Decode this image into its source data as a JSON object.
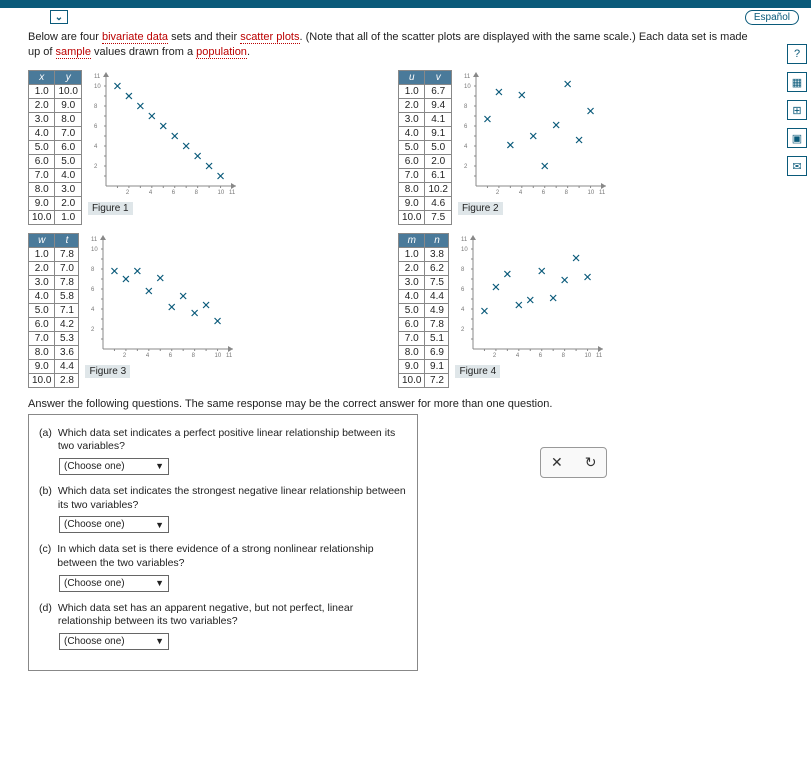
{
  "ui": {
    "espanol": "Español",
    "chev": "⌄"
  },
  "intro": {
    "pre": "Below are four ",
    "term1": "bivariate data",
    "mid1": " sets and their ",
    "term2": "scatter plots",
    "mid2": ". (Note that all of the scatter plots are displayed with the same scale.) Each data set is made up of ",
    "term3": "sample",
    "mid3": " values drawn from a ",
    "term4": "population",
    "end": "."
  },
  "datasets": {
    "xy": {
      "h1": "x",
      "h2": "y",
      "rows": [
        [
          "1.0",
          "10.0"
        ],
        [
          "2.0",
          "9.0"
        ],
        [
          "3.0",
          "8.0"
        ],
        [
          "4.0",
          "7.0"
        ],
        [
          "5.0",
          "6.0"
        ],
        [
          "6.0",
          "5.0"
        ],
        [
          "7.0",
          "4.0"
        ],
        [
          "8.0",
          "3.0"
        ],
        [
          "9.0",
          "2.0"
        ],
        [
          "10.0",
          "1.0"
        ]
      ],
      "fig": "Figure 1"
    },
    "uv": {
      "h1": "u",
      "h2": "v",
      "rows": [
        [
          "1.0",
          "6.7"
        ],
        [
          "2.0",
          "9.4"
        ],
        [
          "3.0",
          "4.1"
        ],
        [
          "4.0",
          "9.1"
        ],
        [
          "5.0",
          "5.0"
        ],
        [
          "6.0",
          "2.0"
        ],
        [
          "7.0",
          "6.1"
        ],
        [
          "8.0",
          "10.2"
        ],
        [
          "9.0",
          "4.6"
        ],
        [
          "10.0",
          "7.5"
        ]
      ],
      "fig": "Figure 2"
    },
    "wt": {
      "h1": "w",
      "h2": "t",
      "rows": [
        [
          "1.0",
          "7.8"
        ],
        [
          "2.0",
          "7.0"
        ],
        [
          "3.0",
          "7.8"
        ],
        [
          "4.0",
          "5.8"
        ],
        [
          "5.0",
          "7.1"
        ],
        [
          "6.0",
          "4.2"
        ],
        [
          "7.0",
          "5.3"
        ],
        [
          "8.0",
          "3.6"
        ],
        [
          "9.0",
          "4.4"
        ],
        [
          "10.0",
          "2.8"
        ]
      ],
      "fig": "Figure 3"
    },
    "mn": {
      "h1": "m",
      "h2": "n",
      "rows": [
        [
          "1.0",
          "3.8"
        ],
        [
          "2.0",
          "6.2"
        ],
        [
          "3.0",
          "7.5"
        ],
        [
          "4.0",
          "4.4"
        ],
        [
          "5.0",
          "4.9"
        ],
        [
          "6.0",
          "7.8"
        ],
        [
          "7.0",
          "5.1"
        ],
        [
          "8.0",
          "6.9"
        ],
        [
          "9.0",
          "9.1"
        ],
        [
          "10.0",
          "7.2"
        ]
      ],
      "fig": "Figure 4"
    }
  },
  "ans_intro": "Answer the following questions. The same response may be the correct answer for more than one question.",
  "questions": {
    "a": {
      "id": "(a)",
      "text": "Which data set indicates a perfect positive linear relationship between its two variables?",
      "sel": "(Choose one)"
    },
    "b": {
      "id": "(b)",
      "text": "Which data set indicates the strongest negative linear relationship between its two variables?",
      "sel": "(Choose one)"
    },
    "c": {
      "id": "(c)",
      "text": "In which data set is there evidence of a strong nonlinear relationship between the two variables?",
      "sel": "(Choose one)"
    },
    "d": {
      "id": "(d)",
      "text": "Which data set has an apparent negative, but not perfect, linear relationship between its two variables?",
      "sel": "(Choose one)"
    }
  },
  "floatbtns": {
    "close": "✕",
    "refresh": "↻"
  },
  "side": {
    "help": "?",
    "calc": "▦",
    "tool": "⊞",
    "save": "▣",
    "mail": "✉"
  },
  "chart_data": [
    {
      "type": "scatter",
      "title": "Figure 1",
      "x": [
        1,
        2,
        3,
        4,
        5,
        6,
        7,
        8,
        9,
        10
      ],
      "y": [
        10,
        9,
        8,
        7,
        6,
        5,
        4,
        3,
        2,
        1
      ],
      "xlim": [
        0,
        11
      ],
      "ylim": [
        0,
        11
      ]
    },
    {
      "type": "scatter",
      "title": "Figure 2",
      "x": [
        1,
        2,
        3,
        4,
        5,
        6,
        7,
        8,
        9,
        10
      ],
      "y": [
        6.7,
        9.4,
        4.1,
        9.1,
        5.0,
        2.0,
        6.1,
        10.2,
        4.6,
        7.5
      ],
      "xlim": [
        0,
        11
      ],
      "ylim": [
        0,
        11
      ]
    },
    {
      "type": "scatter",
      "title": "Figure 3",
      "x": [
        1,
        2,
        3,
        4,
        5,
        6,
        7,
        8,
        9,
        10
      ],
      "y": [
        7.8,
        7.0,
        7.8,
        5.8,
        7.1,
        4.2,
        5.3,
        3.6,
        4.4,
        2.8
      ],
      "xlim": [
        0,
        11
      ],
      "ylim": [
        0,
        11
      ]
    },
    {
      "type": "scatter",
      "title": "Figure 4",
      "x": [
        1,
        2,
        3,
        4,
        5,
        6,
        7,
        8,
        9,
        10
      ],
      "y": [
        3.8,
        6.2,
        7.5,
        4.4,
        4.9,
        7.8,
        5.1,
        6.9,
        9.1,
        7.2
      ],
      "xlim": [
        0,
        11
      ],
      "ylim": [
        0,
        11
      ]
    }
  ]
}
